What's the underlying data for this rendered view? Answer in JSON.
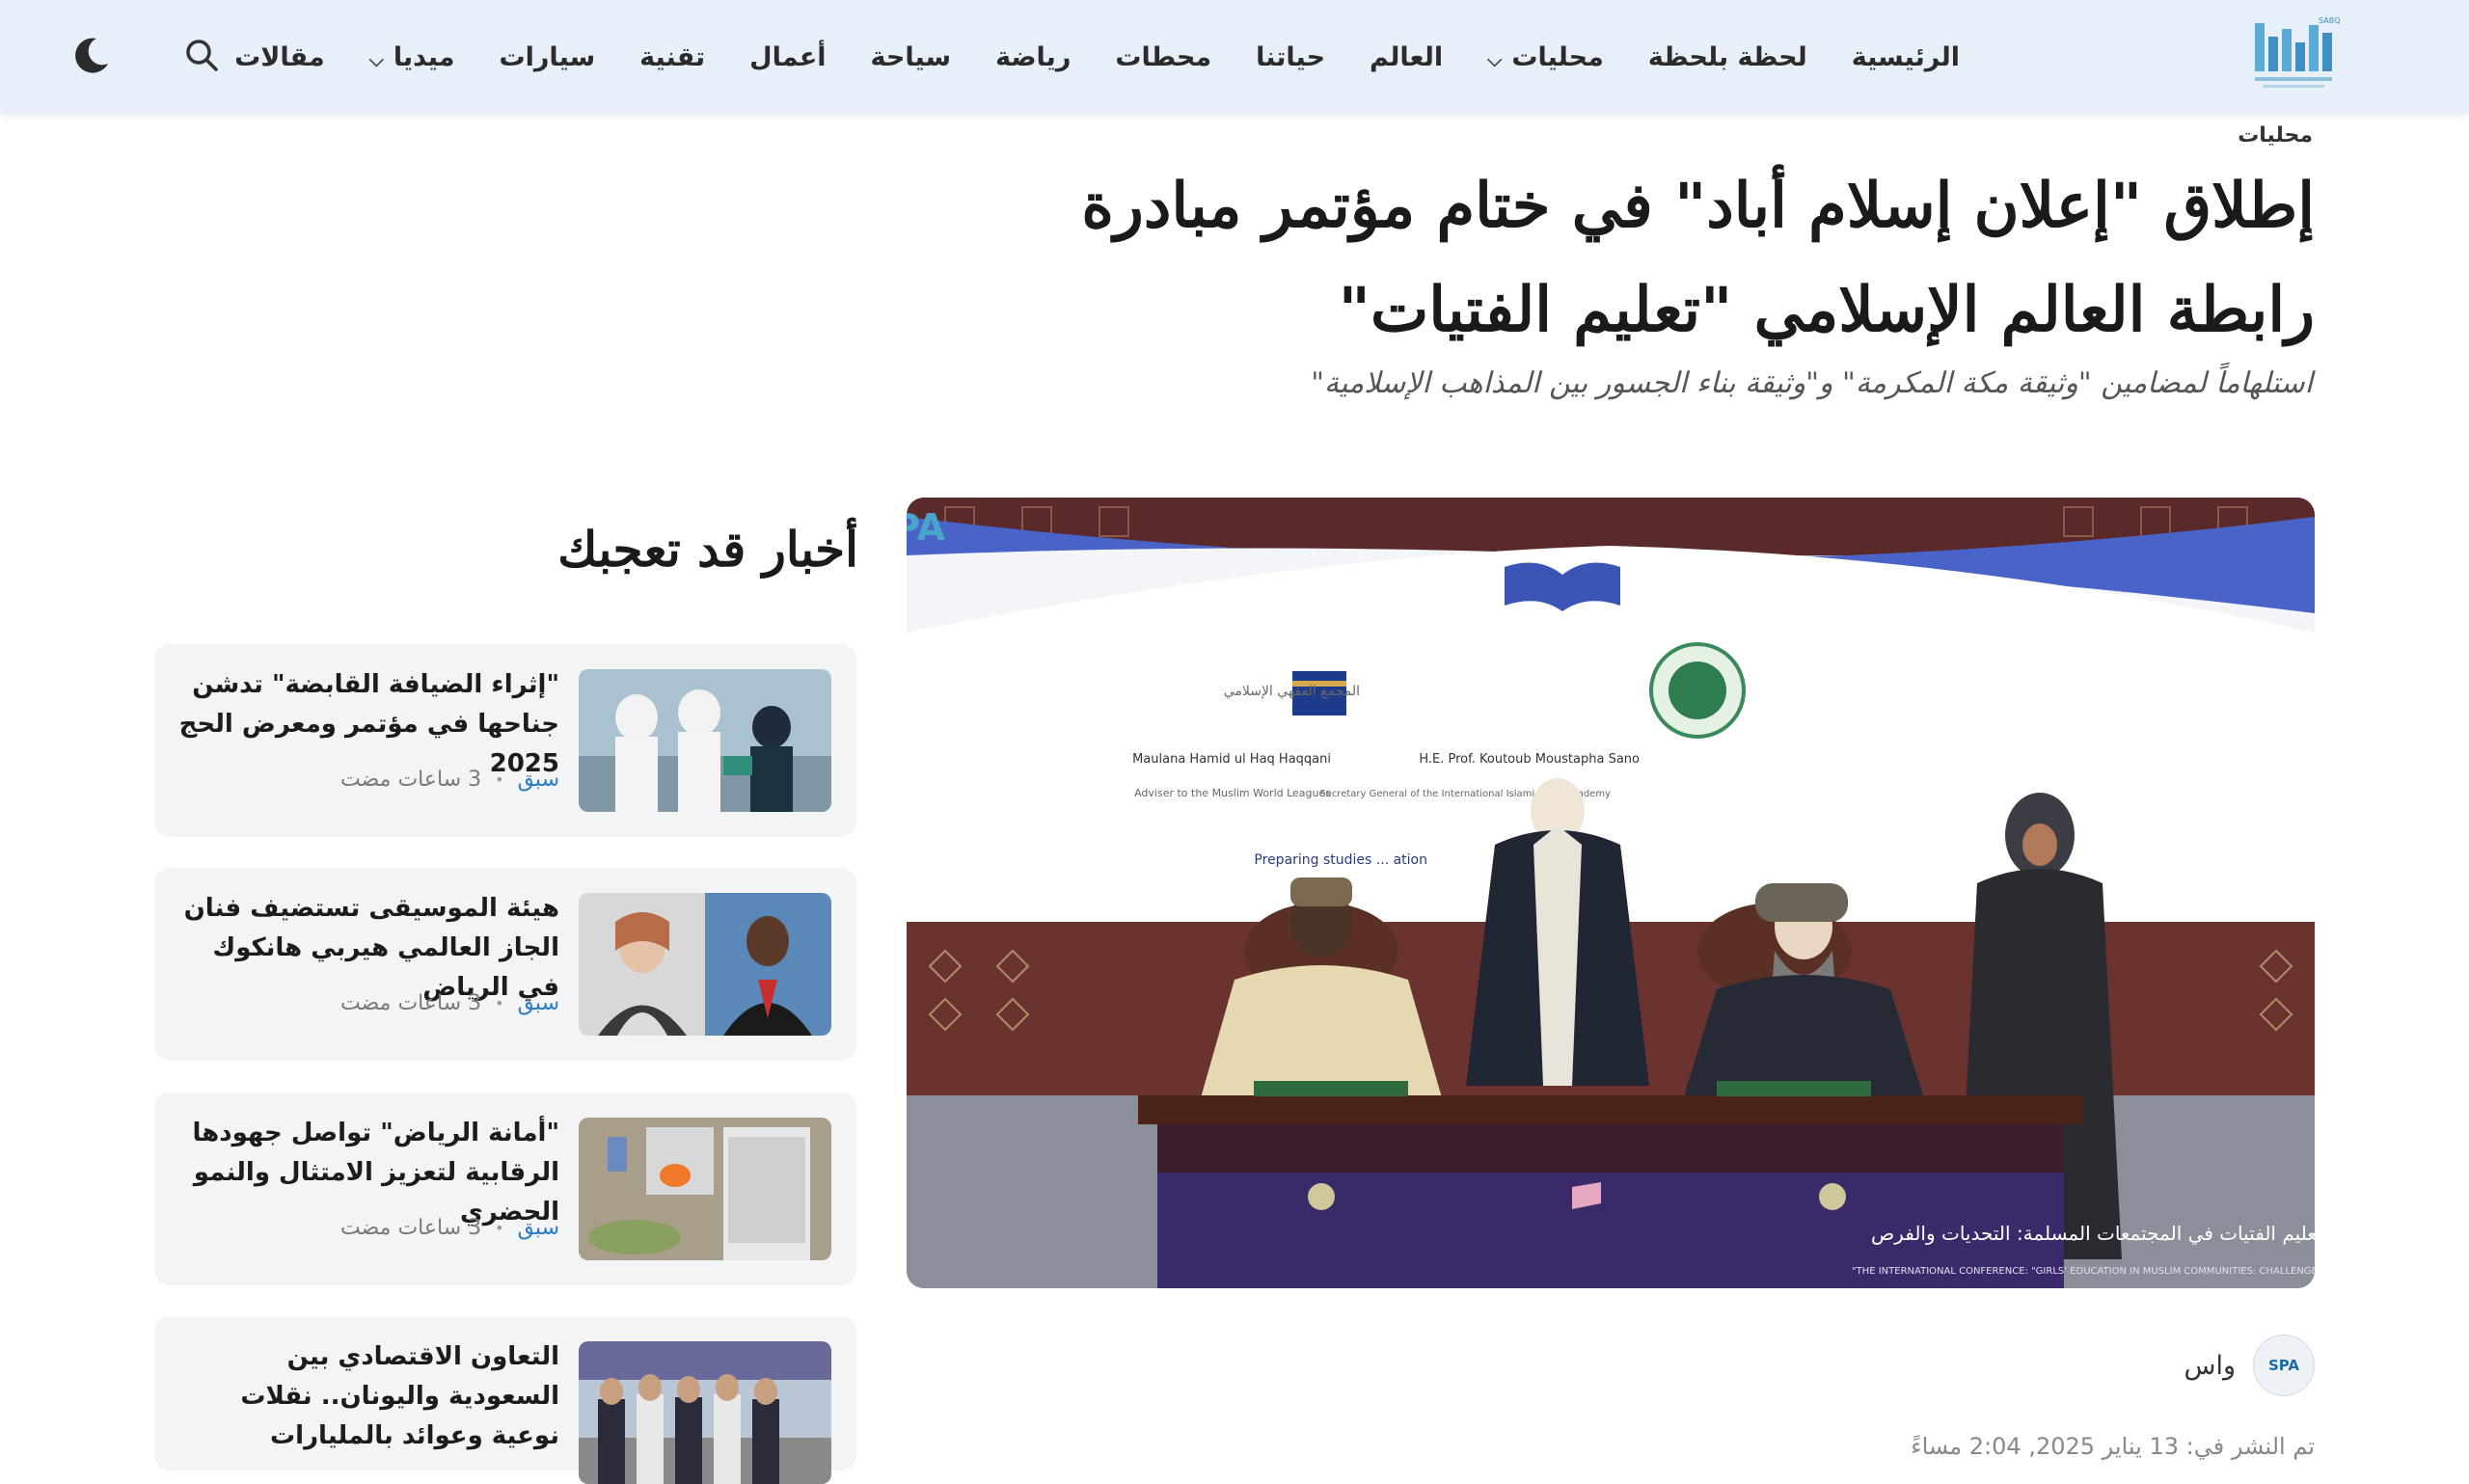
{
  "header": {
    "logo_text": "SABQ",
    "nav": [
      {
        "label": "الرئيسية",
        "has_dropdown": false
      },
      {
        "label": "لحظة بلحظة",
        "has_dropdown": false
      },
      {
        "label": "محليات",
        "has_dropdown": true
      },
      {
        "label": "العالم",
        "has_dropdown": false
      },
      {
        "label": "حياتنا",
        "has_dropdown": false
      },
      {
        "label": "محطات",
        "has_dropdown": false
      },
      {
        "label": "رياضة",
        "has_dropdown": false
      },
      {
        "label": "سياحة",
        "has_dropdown": false
      },
      {
        "label": "أعمال",
        "has_dropdown": false
      },
      {
        "label": "تقنية",
        "has_dropdown": false
      },
      {
        "label": "سيارات",
        "has_dropdown": false
      },
      {
        "label": "ميديا",
        "has_dropdown": true
      },
      {
        "label": "مقالات",
        "has_dropdown": false
      }
    ],
    "icons": {
      "search": "search-icon",
      "theme": "moon-icon"
    },
    "bg_color": "#e7f0f8"
  },
  "article": {
    "section": "محليات",
    "headline": "إطلاق \"إعلان إسلام أباد\" في ختام مؤتمر مبادرة رابطة العالم الإسلامي \"تعليم الفتيات\"",
    "subtitle": "استلهاماً لمضامين \"وثيقة مكة المكرمة\" و\"وثيقة بناء الجسور بين المذاهب الإسلامية\"",
    "image": {
      "watermark": "SPA",
      "left_name": "Maulana Hamid ul Haq Haqqani",
      "left_role": "Adviser to the Muslim World Leagues",
      "right_name": "H.E. Prof. Koutoub Moustapha Sano",
      "right_role": "Secretary General of the International Islamic Fiqh Academy",
      "screen_caption": "Preparing studies ... ation",
      "banner_ar": "المؤتمر العالمي: تعليم الفتيات في المجتمعات المسلمة: التحديات والفرص",
      "banner_en": "THE INTERNATIONAL CONFERENCE: \"GIRLS' EDUCATION IN MUSLIM COMMUNITIES: CHALLENGES AND OPPORTUNITIES\""
    },
    "byline": {
      "avatar_text": "SPA",
      "name": "واس"
    },
    "published": "تم النشر في: 13 يناير 2025, 2:04 مساءً"
  },
  "sidebar": {
    "title": "أخبار قد تعجبك",
    "items": [
      {
        "title": "\"إثراء الضيافة القابضة\" تدشن جناحها في مؤتمر ومعرض الحج 2025",
        "source": "سبق",
        "time": "3 ساعات مضت"
      },
      {
        "title": "هيئة الموسيقى تستضيف فنان الجاز العالمي هيربي هانكوك في الرياض",
        "source": "سبق",
        "time": "3 ساعات مضت"
      },
      {
        "title": "\"أمانة الرياض\" تواصل جهودها الرقابية لتعزيز الامتثال والنمو الحضري",
        "source": "سبق",
        "time": "3 ساعات مضت"
      },
      {
        "title": "التعاون الاقتصادي بين السعودية واليونان.. نقلات نوعية وعوائد بالمليارات",
        "source": "",
        "time": ""
      }
    ]
  }
}
